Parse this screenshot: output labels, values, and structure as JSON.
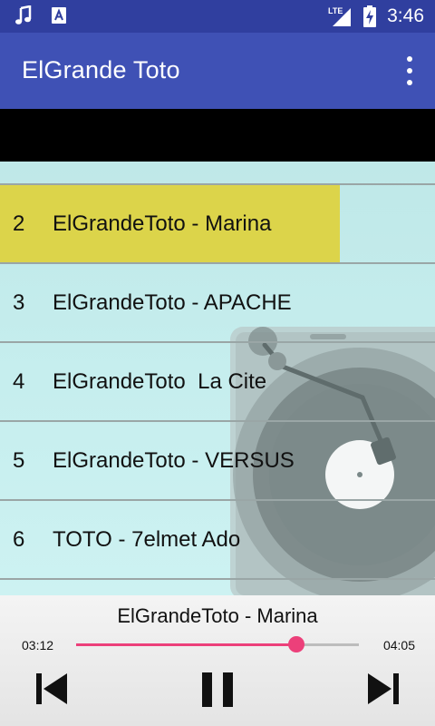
{
  "status_bar": {
    "time": "3:46",
    "network": "LTE",
    "icons": [
      "music-note-icon",
      "text-a-icon",
      "lte-signal-icon",
      "battery-charging-icon"
    ]
  },
  "app_bar": {
    "title": "ElGrande Toto",
    "menu_icon": "overflow-menu-icon"
  },
  "tracks": [
    {
      "number": "2",
      "title": "ElGrandeToto - Marina",
      "active": true
    },
    {
      "number": "3",
      "title": "ElGrandeToto - APACHE",
      "active": false
    },
    {
      "number": "4",
      "title": "ElGrandeToto  La Cite",
      "active": false
    },
    {
      "number": "5",
      "title": "ElGrandeToto - VERSUS",
      "active": false
    },
    {
      "number": "6",
      "title": "TOTO - 7elmet Ado",
      "active": false
    }
  ],
  "player": {
    "now_playing": "ElGrandeToto - Marina",
    "current_time": "03:12",
    "total_time": "04:05",
    "progress": 0.78,
    "controls": [
      "skip-previous-icon",
      "pause-icon",
      "skip-next-icon"
    ]
  },
  "colors": {
    "status_bar": "#303f9f",
    "app_bar": "#3f51b5",
    "active_row": "#dcd44a",
    "accent": "#ec407a",
    "list_bg": "#c6eeee"
  }
}
